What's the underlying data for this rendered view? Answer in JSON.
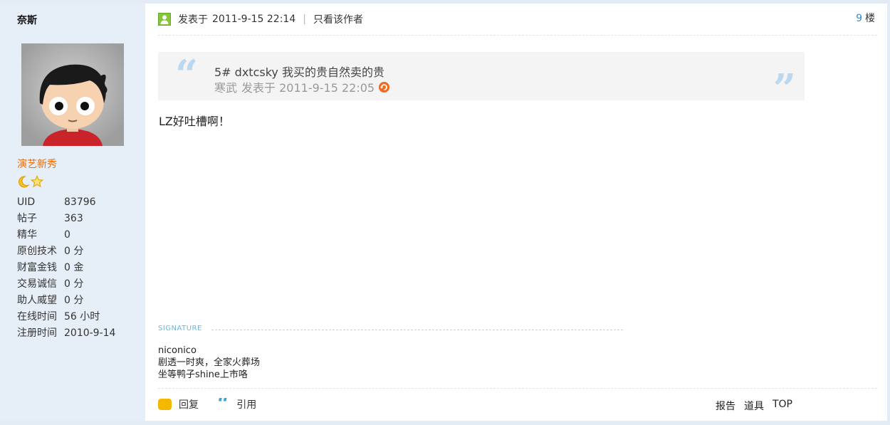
{
  "user": {
    "name": "奈斯",
    "rank": "演艺新秀",
    "stats": [
      {
        "label": "UID",
        "value": "83796"
      },
      {
        "label": "帖子",
        "value": "363"
      },
      {
        "label": "精华",
        "value": "0"
      },
      {
        "label": "原创技术",
        "value": "0 分"
      },
      {
        "label": "财富金钱",
        "value": "0 金"
      },
      {
        "label": "交易诚信",
        "value": "0 分"
      },
      {
        "label": "助人威望",
        "value": "0 分"
      },
      {
        "label": "在线时间",
        "value": "56 小时"
      },
      {
        "label": "注册时间",
        "value": "2010-9-14"
      }
    ]
  },
  "post": {
    "posted_prefix": "发表于",
    "posted_time": "2011-9-15 22:14",
    "separator": "|",
    "only_author": "只看该作者",
    "floor_number": "9",
    "floor_unit": "楼",
    "quote": {
      "line1": "5# dxtcsky 我买的贵自然卖的贵",
      "author": "寒武",
      "posted": "发表于 2011-9-15 22:05"
    },
    "message": "LZ好吐槽啊！"
  },
  "signature": {
    "title": "SIGNATURE",
    "lines": [
      "niconico",
      "剧透一时爽，全家火葬场",
      "坐等鸭子shine上市咯"
    ]
  },
  "actions": {
    "reply": "回复",
    "quote": "引用",
    "report": "报告",
    "tools": "道具",
    "top": "TOP"
  },
  "colors": {
    "sidebar_bg": "#e6eef7",
    "rank_orange": "#e46e0e",
    "floor_blue": "#3389c7",
    "signature_blue": "#69b6dd"
  }
}
